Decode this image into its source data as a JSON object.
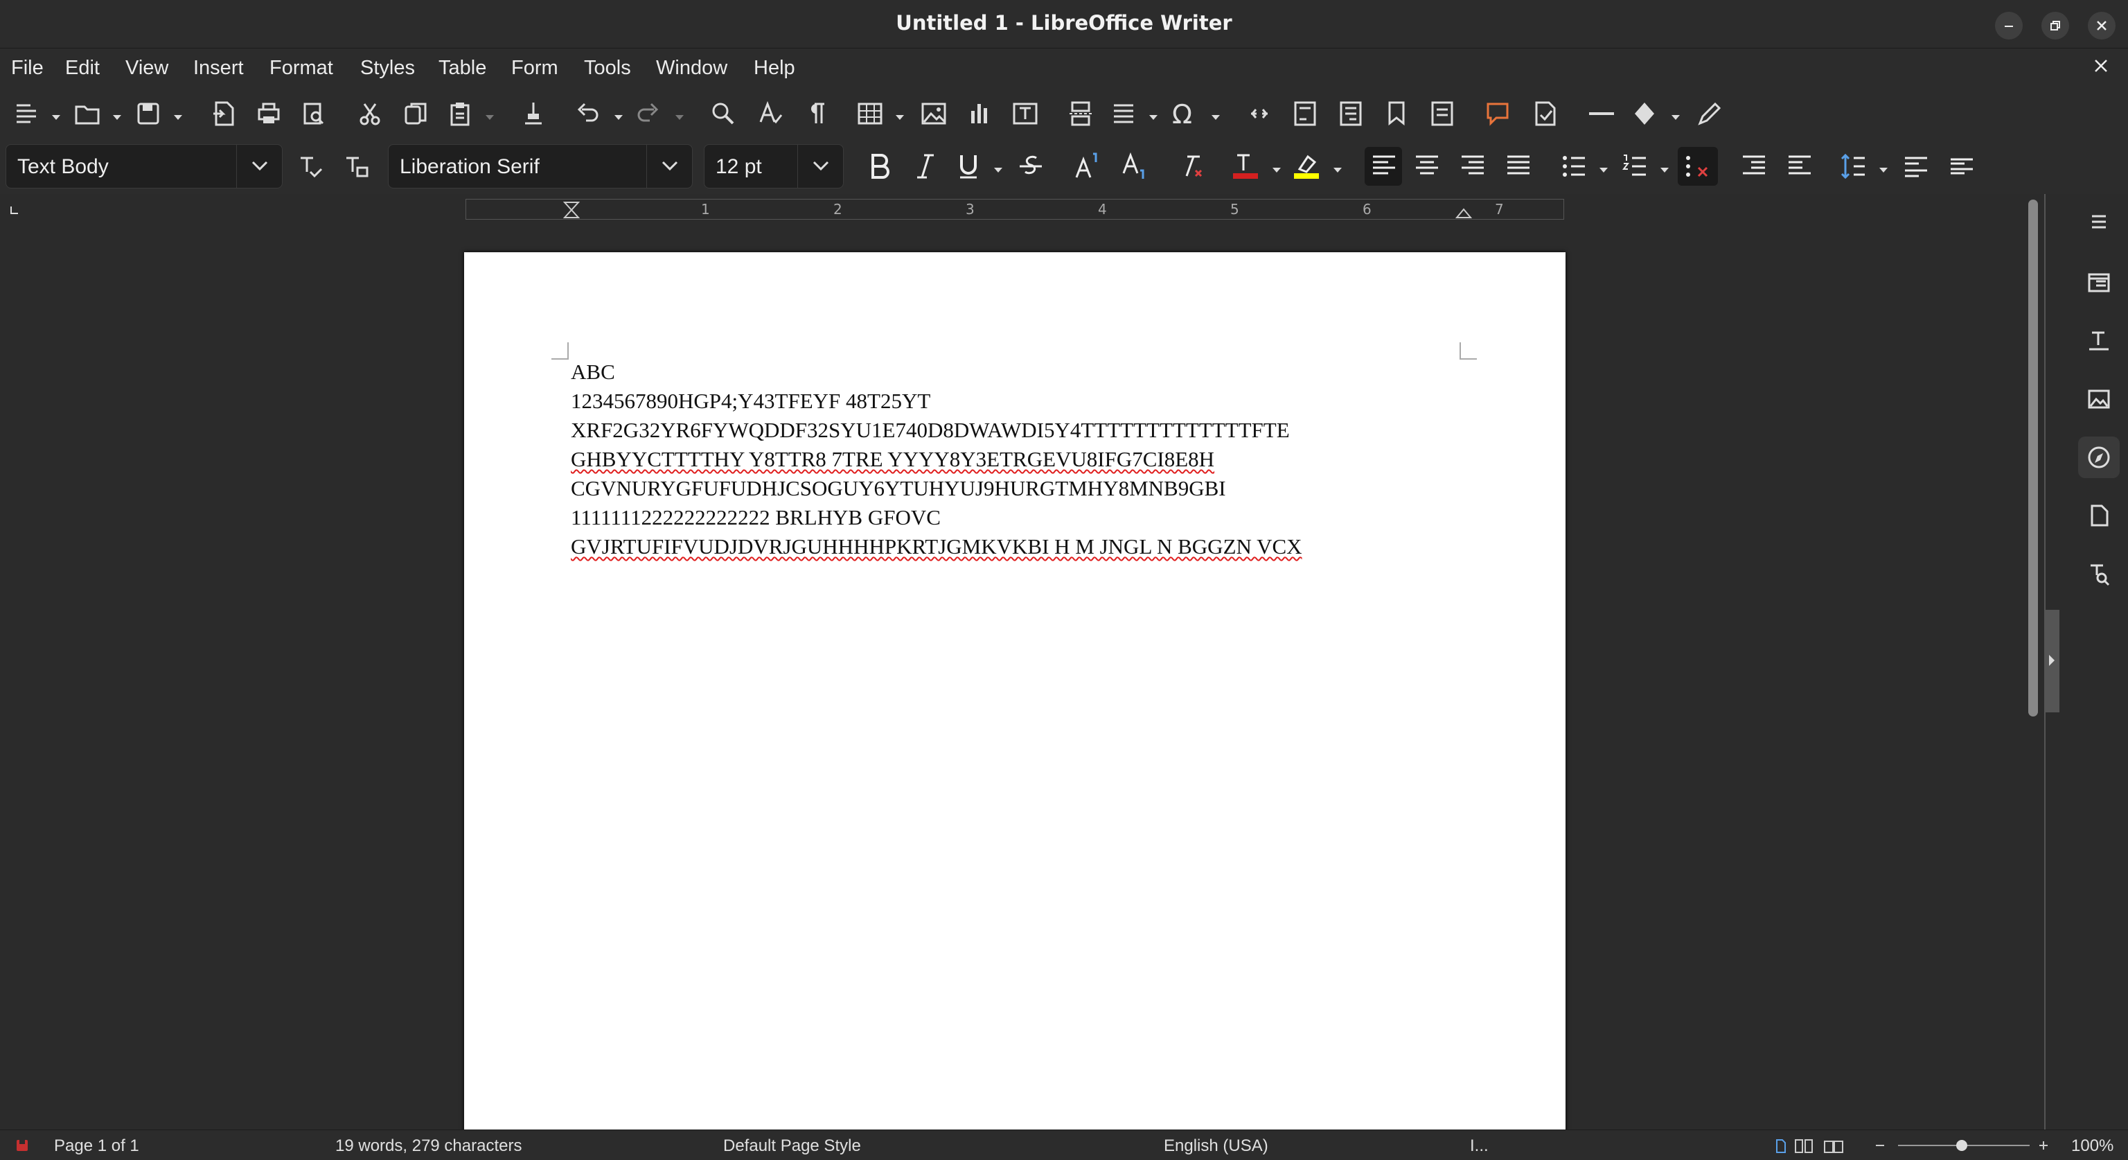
{
  "window": {
    "title": "Untitled 1 - LibreOffice Writer"
  },
  "menu": [
    "File",
    "Edit",
    "View",
    "Insert",
    "Format",
    "Styles",
    "Table",
    "Form",
    "Tools",
    "Window",
    "Help"
  ],
  "formatting": {
    "paragraph_style": "Text Body",
    "font_name": "Liberation Serif",
    "font_size": "12 pt",
    "font_color": "#d42020",
    "highlight_color": "#ffff00"
  },
  "ruler": {
    "labels": [
      "1",
      "2",
      "3",
      "4",
      "5",
      "6",
      "7"
    ]
  },
  "document": {
    "lines": [
      "ABC",
      "1234567890HGP4;Y43TFEYF 48T25YT",
      "XRF2G32YR6FYWQDDF32SYU1E740D8DWAWDI5Y4TTTTTTTTTTTTTFTE",
      "GHBYYCTTTTHY Y8TTR8 7TRE YYYY8Y3ETRGEVU8IFG7CI8E8H",
      "CGVNURYGFUFUDHJCSOGUY6YTUHYUJ9HURGTMHY8MNB9GBI",
      "1111111222222222222 BRLHYB GFOVC",
      "GVJRTUFIFVUDJDVRJGUHHHHPKRTJGMKVKBI H M JNGL N BGGZN VCX"
    ]
  },
  "status": {
    "page": "Page 1 of 1",
    "words": "19 words, 279 characters",
    "page_style": "Default Page Style",
    "language": "English (USA)",
    "selection_mode": "I...",
    "zoom": "100%"
  }
}
